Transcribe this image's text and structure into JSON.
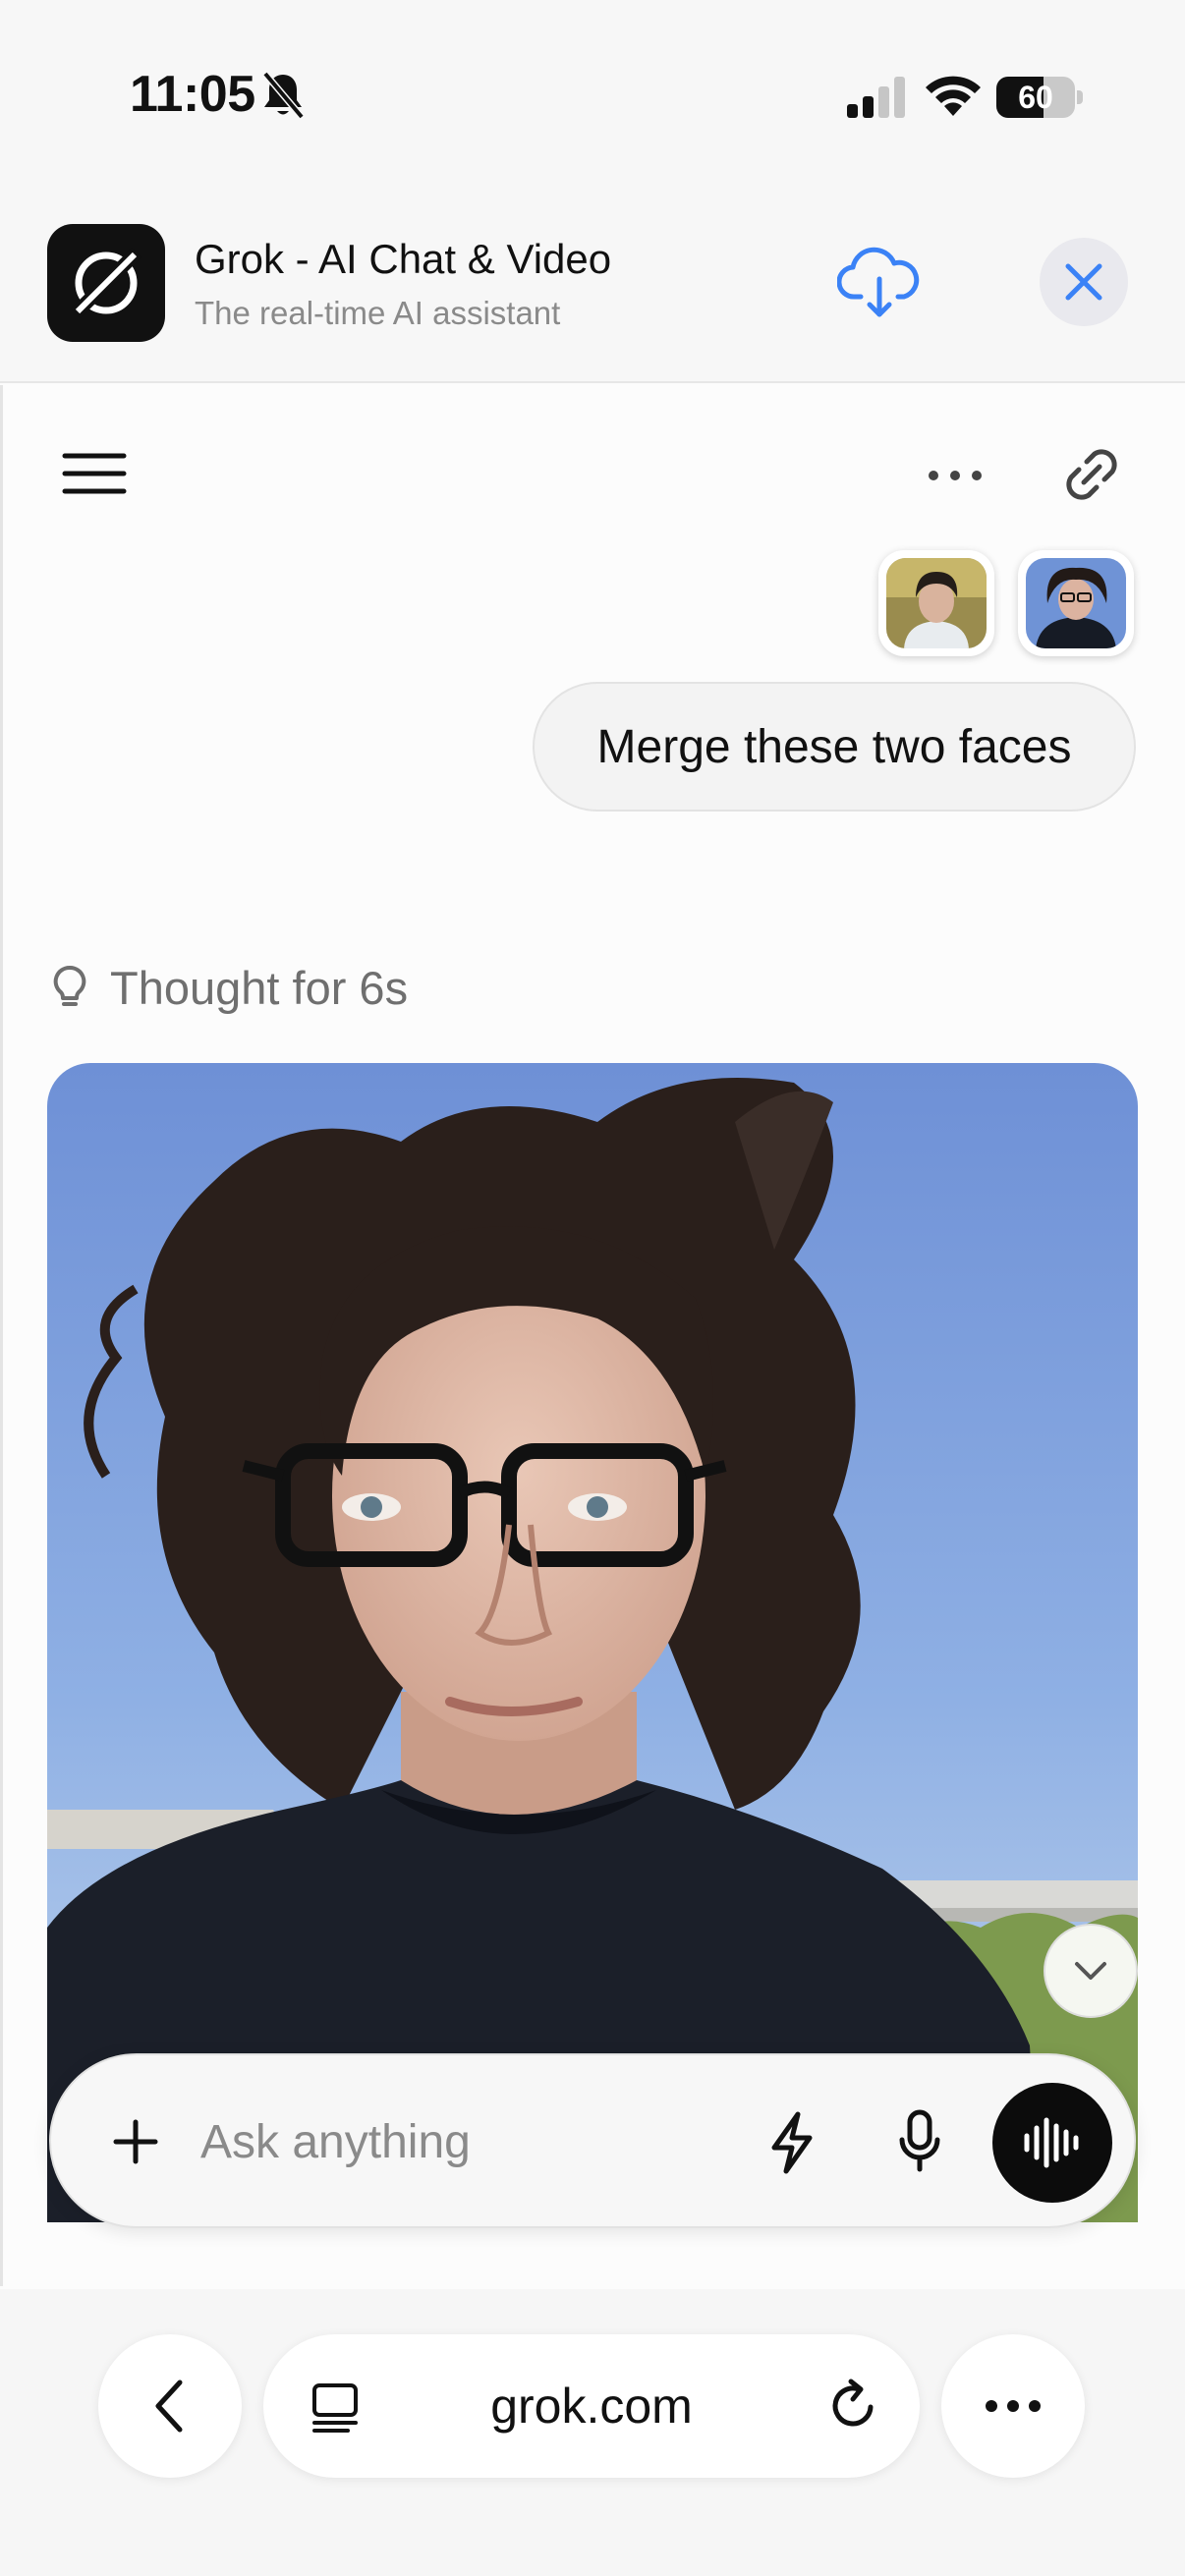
{
  "status_bar": {
    "time": "11:05",
    "battery_level": "60",
    "battery_fraction": 0.6
  },
  "app_banner": {
    "title": "Grok - AI Chat & Video",
    "subtitle": "The real-time AI assistant",
    "icons": [
      "grok-logo-icon",
      "cloud-download-icon",
      "close-icon"
    ],
    "accent_color": "#3b82f6"
  },
  "chat_header": {
    "icons": [
      "hamburger-menu-icon",
      "more-horizontal-icon",
      "link-icon"
    ]
  },
  "conversation": {
    "user_message": "Merge these two faces",
    "thought_label": "Thought for 6s"
  },
  "composer": {
    "placeholder": "Ask anything",
    "icons": [
      "plus-icon",
      "lightning-icon",
      "microphone-icon",
      "voice-waveform-icon"
    ]
  },
  "browser": {
    "url": "grok.com",
    "icons": [
      "chevron-left-icon",
      "tabs-icon",
      "reload-icon",
      "more-horizontal-icon"
    ]
  }
}
